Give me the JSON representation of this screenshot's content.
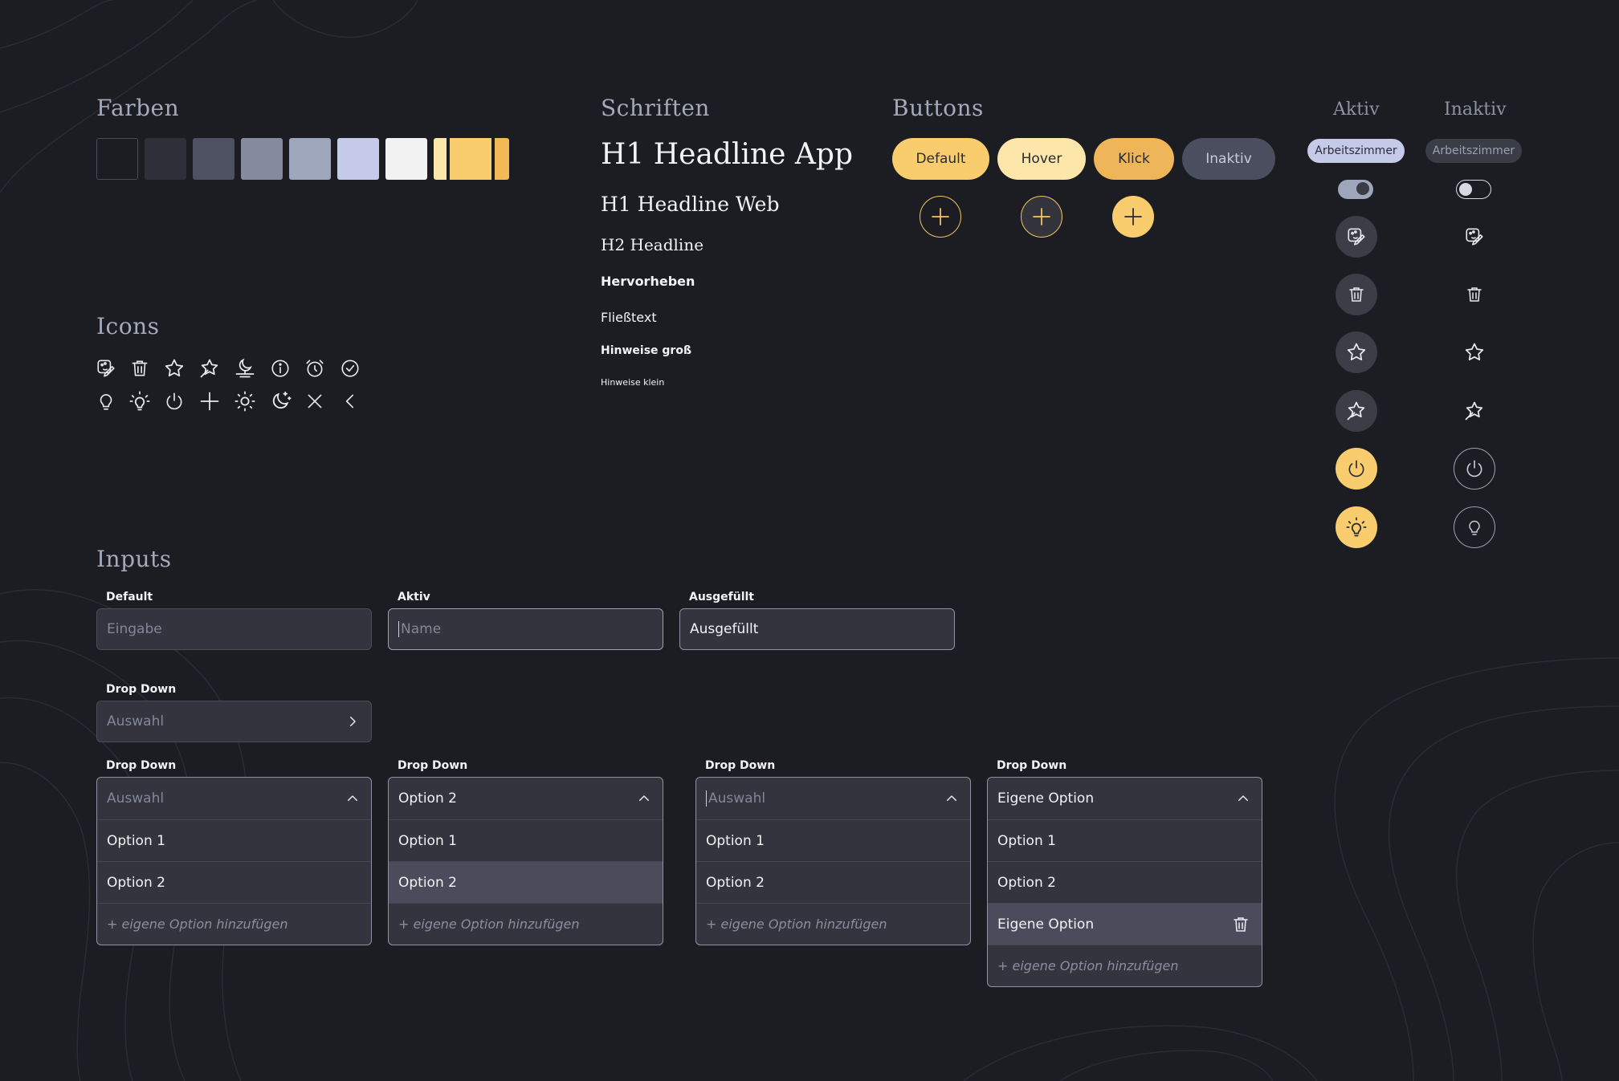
{
  "sections": {
    "farben": "Farben",
    "schriften": "Schriften",
    "buttons": "Buttons",
    "aktiv": "Aktiv",
    "inaktiv": "Inaktiv",
    "icons": "Icons",
    "inputs": "Inputs"
  },
  "colors": [
    "#1c1d22",
    "#2e3039",
    "#4d5162",
    "#858a9d",
    "#9ea6bb",
    "#c5cae8",
    "#f2f2f2",
    "#fce6a9",
    "#f9cd6d",
    "#f3b956"
  ],
  "typography": {
    "h1_app": "H1 Headline App",
    "h1_web": "H1 Headline Web",
    "h2": "H2 Headline",
    "hervorheben": "Hervorheben",
    "fliesstext": "Fließtext",
    "hinweise_gross": "Hinweise groß",
    "hinweise_klein": "Hinweise klein"
  },
  "buttons": {
    "default": "Default",
    "hover": "Hover",
    "klick": "Klick",
    "inaktiv": "Inaktiv",
    "default_color": "#f9cd6d",
    "hover_color": "#fce6a9",
    "klick_color": "#eeb658",
    "inaktiv_color": "#4b4e5e"
  },
  "states": {
    "chip_active": "Arbeitszimmer",
    "chip_inactive": "Arbeitszimmer"
  },
  "icons": {
    "row1": [
      "palette-icon",
      "trash-icon",
      "star-icon",
      "magic-star-icon",
      "moon-landscape-icon",
      "info-icon",
      "alarm-icon",
      "check-circle-icon"
    ],
    "row2": [
      "bulb-icon",
      "bulb-on-icon",
      "power-icon",
      "plus-icon",
      "sun-icon",
      "moon-stars-icon",
      "close-icon",
      "chevron-left-icon"
    ]
  },
  "inputs": {
    "default": {
      "label": "Default",
      "placeholder": "Eingabe"
    },
    "aktiv": {
      "label": "Aktiv",
      "placeholder": "Name"
    },
    "ausgefuellt": {
      "label": "Ausgefüllt",
      "value": "Ausgefüllt"
    },
    "dropdown_closed": {
      "label": "Drop Down",
      "placeholder": "Auswahl"
    },
    "dropdowns": [
      {
        "label": "Drop Down",
        "head": "Auswahl",
        "options": [
          "Option 1",
          "Option 2"
        ],
        "add": "+ eigene Option hinzufügen"
      },
      {
        "label": "Drop Down",
        "head": "Option 2",
        "options": [
          "Option 1",
          "Option 2"
        ],
        "add": "+ eigene Option hinzufügen"
      },
      {
        "label": "Drop Down",
        "head": "Auswahl",
        "options": [
          "Option 1",
          "Option 2"
        ],
        "add": "+ eigene Option hinzufügen"
      },
      {
        "label": "Drop Down",
        "head": "Eigene Option",
        "options": [
          "Option 1",
          "Option 2",
          "Eigene Option"
        ],
        "add": "+ eigene Option hinzufügen"
      }
    ]
  }
}
